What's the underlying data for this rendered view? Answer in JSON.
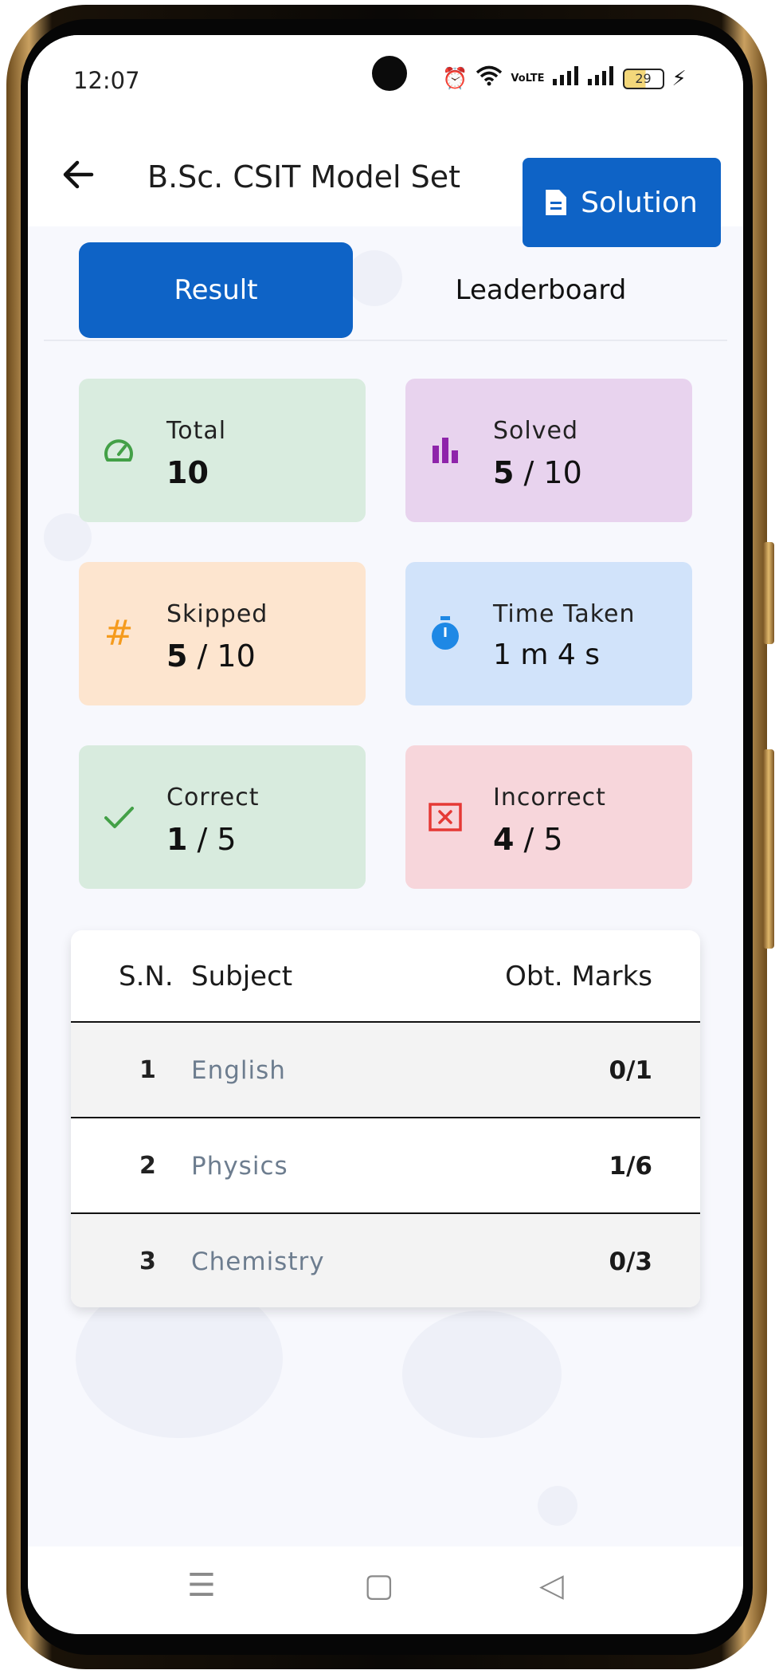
{
  "status_bar": {
    "time": "12:07",
    "battery": "29",
    "network_tag": "VoLTE"
  },
  "app_bar": {
    "title": "B.Sc. CSIT Model Set",
    "solution_label": "Solution"
  },
  "tabs": [
    {
      "label": "Result",
      "active": true
    },
    {
      "label": "Leaderboard",
      "active": false
    }
  ],
  "stats": {
    "total": {
      "label": "Total",
      "value": "10",
      "icon": "speedometer-icon",
      "bg": "#d9ecdf",
      "icon_color": "#43a047"
    },
    "solved": {
      "label": "Solved",
      "value": "5",
      "of": "/ 10",
      "icon": "bar-chart-icon",
      "bg": "#e8d3ee",
      "icon_color": "#8e24aa"
    },
    "skipped": {
      "label": "Skipped",
      "value": "5",
      "of": "/ 10",
      "icon": "hash-icon",
      "bg": "#fde5cf",
      "icon_color": "#f59b1d"
    },
    "time_taken": {
      "label": "Time Taken",
      "value": "1 m 4 s",
      "icon": "stopwatch-icon",
      "bg": "#d1e3fa",
      "icon_color": "#1e88e5"
    },
    "correct": {
      "label": "Correct",
      "value": "1",
      "of": "/ 5",
      "icon": "check-icon",
      "bg": "#d8ebde",
      "icon_color": "#43a047"
    },
    "incorrect": {
      "label": "Incorrect",
      "value": "4",
      "of": "/ 5",
      "icon": "close-box-icon",
      "bg": "#f7d6db",
      "icon_color": "#e53935"
    }
  },
  "table": {
    "headers": [
      "S.N.",
      "Subject",
      "Obt. Marks"
    ],
    "rows": [
      {
        "sn": "1",
        "subject": "English",
        "marks": "0/1"
      },
      {
        "sn": "2",
        "subject": "Physics",
        "marks": "1/6"
      },
      {
        "sn": "3",
        "subject": "Chemistry",
        "marks": "0/3"
      }
    ]
  },
  "nav_bar": {
    "menu_icon": "☰",
    "home_icon": "▢",
    "back_icon": "◁"
  }
}
